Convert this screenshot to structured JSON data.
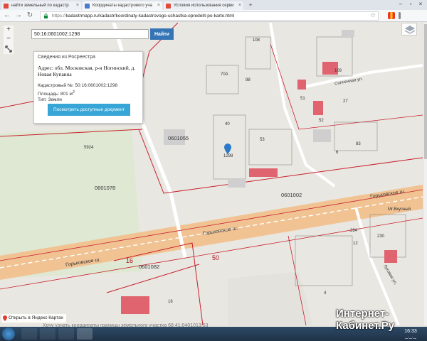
{
  "browser": {
    "tabs": [
      {
        "title": "найти земельный по кадастр",
        "favicon_color": "#e14b3c",
        "active": false
      },
      {
        "title": "Координаты кадастрового уча",
        "favicon_color": "#4a7bd0",
        "active": true
      },
      {
        "title": "Условия использования серви",
        "favicon_color": "#e14b3c",
        "active": false
      }
    ],
    "close_glyph": "×",
    "new_tab_glyph": "+",
    "url_https": "https://",
    "url_rest": "kadastrmapp.ru/kadastr/koordinaty-kadastrovogo-uchastka-opredelit-po-karte.html",
    "icons": [
      "back-icon",
      "forward-icon",
      "reload-icon",
      "lock-icon",
      "star-icon"
    ]
  },
  "map": {
    "search": {
      "value": "50:16:0601002:1298",
      "button": "Найти"
    },
    "zoom": {
      "in": "+",
      "out": "−"
    },
    "labels": {
      "parcel_0601055": "0601055",
      "parcel_0601078": "0601078",
      "parcel_0601002": "0601002",
      "parcel_0601082": "0601082",
      "region_50": "50",
      "region_16": "16",
      "street_gorkovskoe_1": "Горьковское ш.",
      "street_gorkovskoe_2": "Горьковское ш.",
      "street_gorkovskoe_3": "Горьковское ш.",
      "street_solnechnaya": "Солнечная ул.",
      "street_lugovaya": "Луговая ул.",
      "poi": "Mr.Вкусный",
      "num_108": "108",
      "num_70a": "70А",
      "num_109": "109",
      "num_98": "98",
      "num_51": "51",
      "num_27": "27",
      "num_52": "52",
      "num_40": "40",
      "num_83": "83",
      "num_6": "6",
      "num_53": "53",
      "num_1298": "1298",
      "num_5924": "5924",
      "num_284": "284",
      "num_12": "12",
      "num_230": "230",
      "num_4": "4",
      "num_16": "16"
    },
    "info": {
      "title": "Сведения из Росреестра",
      "address": "Адрес: обл. Московская, р-н Ногинский, д. Новая Купавна",
      "cadastral": "Кадастровый №: 50:16:0601002:1298",
      "area_label": "Площадь: 801 м",
      "area_sup": "2",
      "type": "Тип: Земли",
      "button": "Посмотреть доступные документ"
    },
    "yandex_link": "Открыть в Яндекс Картах",
    "coord_line": "Хочу узнать координаты границы земельного участка 66:41:0401013:53",
    "colors": {
      "road": "#f1c292",
      "parcel_border": "#c8202c",
      "green": "#dde8cf",
      "building": "#e06470"
    }
  },
  "taskbar": {
    "clock_time": "16:33",
    "clock_date": "_._._"
  },
  "watermark": {
    "line1": "Интернет-",
    "line2": "Кабинет.Ру"
  }
}
